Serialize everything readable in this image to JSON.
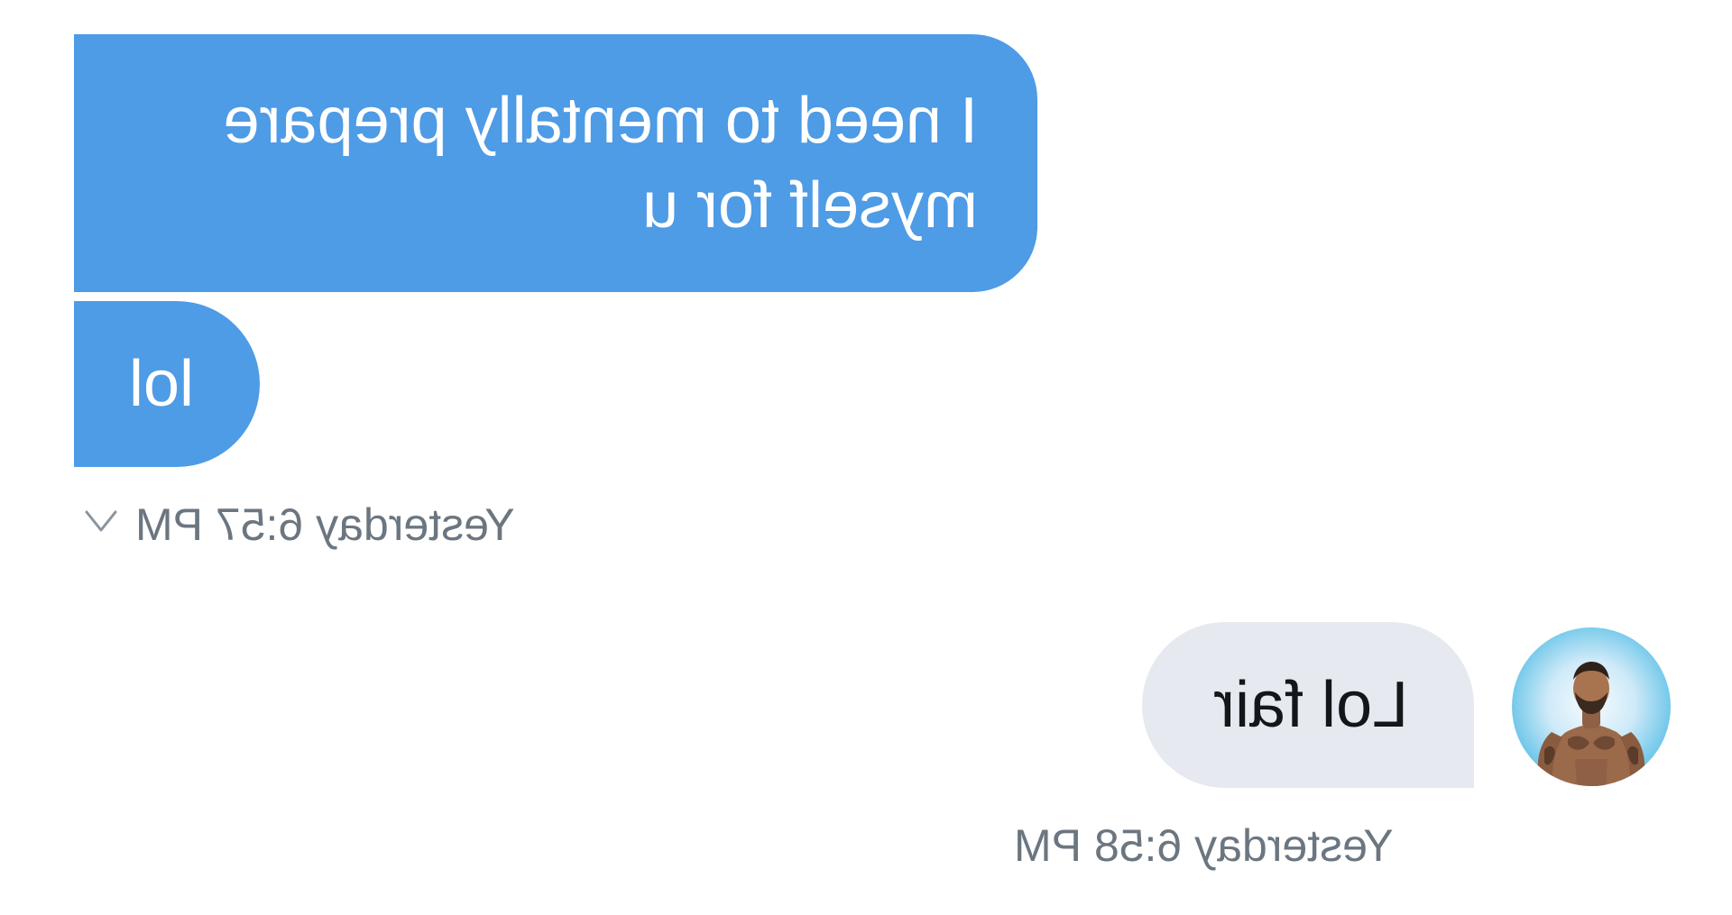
{
  "conversation": {
    "incoming_group": {
      "messages": [
        {
          "text": "I need to mentally prepare myself for u"
        },
        {
          "text": "lol"
        }
      ],
      "timestamp": "Yesterday 6:57 PM",
      "chevron_icon": "chevron-down-icon"
    },
    "outgoing_group": {
      "messages": [
        {
          "text": "Lol fair"
        }
      ],
      "timestamp": "Yesterday 6:58 PM",
      "avatar_icon": "user-avatar"
    }
  },
  "colors": {
    "incoming_bubble": "#4e9be6",
    "outgoing_bubble": "#e6e9ef",
    "timestamp_text": "#6b7680",
    "background": "#ffffff"
  }
}
